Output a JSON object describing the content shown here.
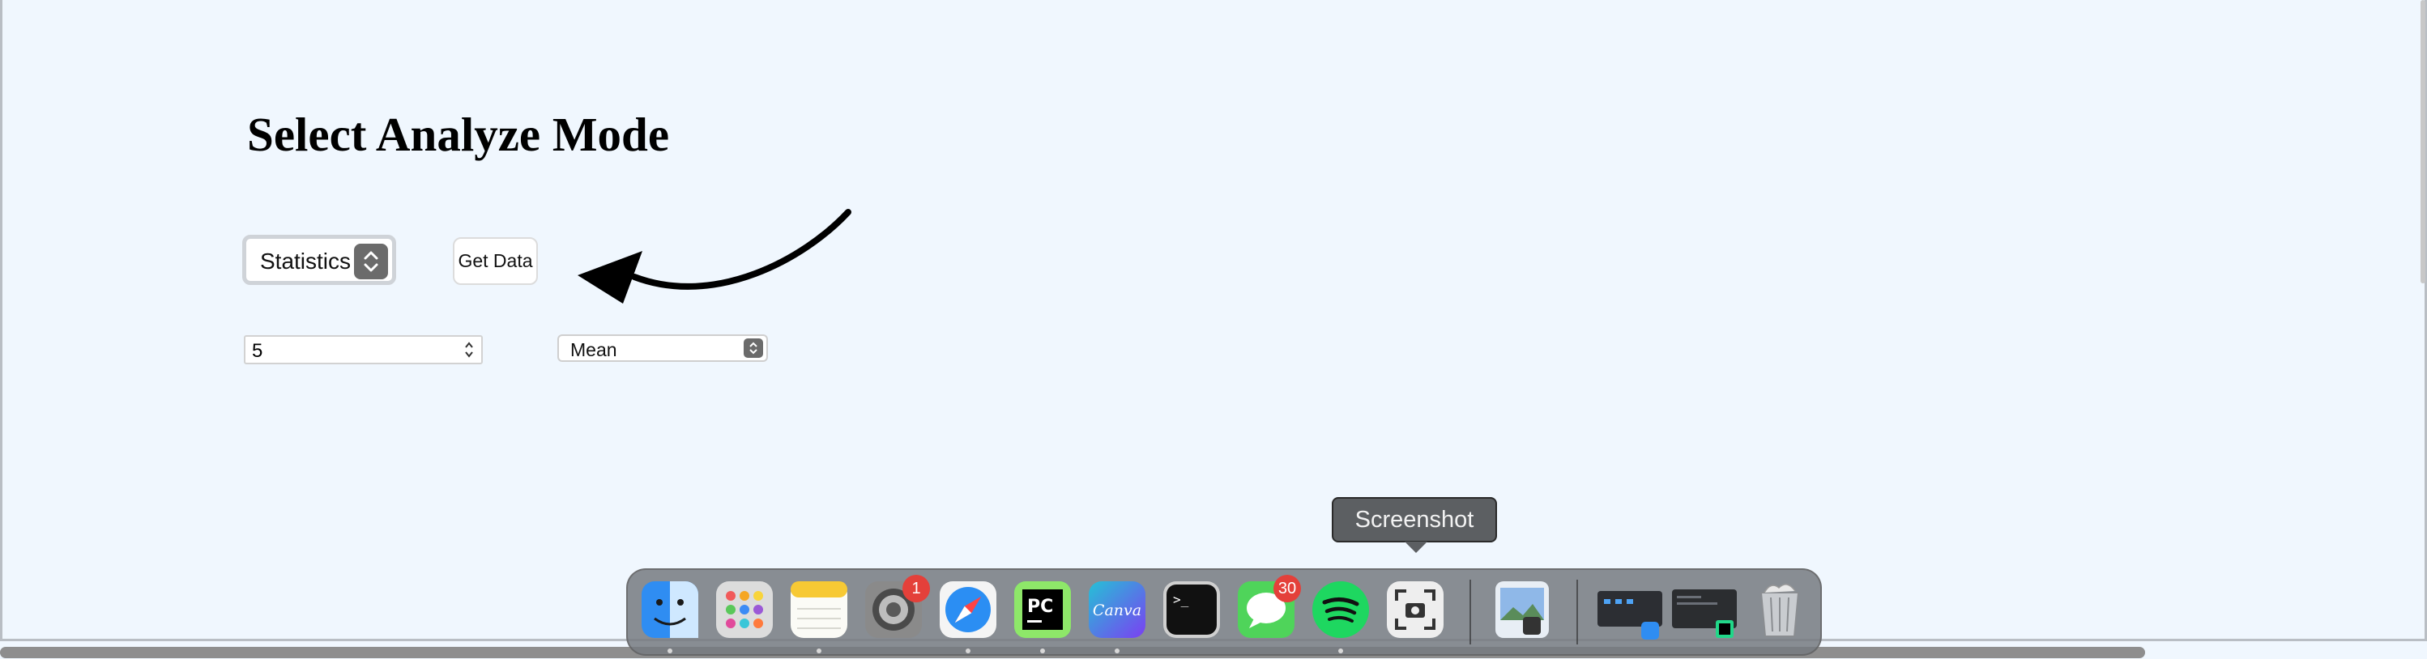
{
  "page": {
    "title": "Select Analyze Mode"
  },
  "controls": {
    "mode_select_value": "Statistics",
    "get_data_label": "Get Data",
    "number_value": "5",
    "stat_select_value": "Mean"
  },
  "tooltip": {
    "text": "Screenshot"
  },
  "dock": {
    "items": [
      {
        "name": "Finder",
        "icon": "finder-icon"
      },
      {
        "name": "Launchpad",
        "icon": "launchpad-icon"
      },
      {
        "name": "Notes",
        "icon": "notes-icon"
      },
      {
        "name": "System Settings",
        "icon": "settings-icon",
        "badge": "1"
      },
      {
        "name": "Safari",
        "icon": "safari-icon"
      },
      {
        "name": "PyCharm",
        "icon": "pycharm-icon",
        "text": "PC"
      },
      {
        "name": "Canva",
        "icon": "canva-icon",
        "text": "Canva"
      },
      {
        "name": "Terminal",
        "icon": "terminal-icon",
        "text": ">_"
      },
      {
        "name": "Messages",
        "icon": "messages-icon",
        "badge": "30"
      },
      {
        "name": "Spotify",
        "icon": "spotify-icon"
      },
      {
        "name": "Screenshot",
        "icon": "screenshot-icon"
      },
      {
        "name": "Preview",
        "icon": "preview-icon"
      },
      {
        "name": "Finder Window",
        "icon": "finder-window-icon"
      },
      {
        "name": "PyCharm Window",
        "icon": "pycharm-window-icon"
      },
      {
        "name": "Trash",
        "icon": "trash-icon"
      }
    ]
  }
}
